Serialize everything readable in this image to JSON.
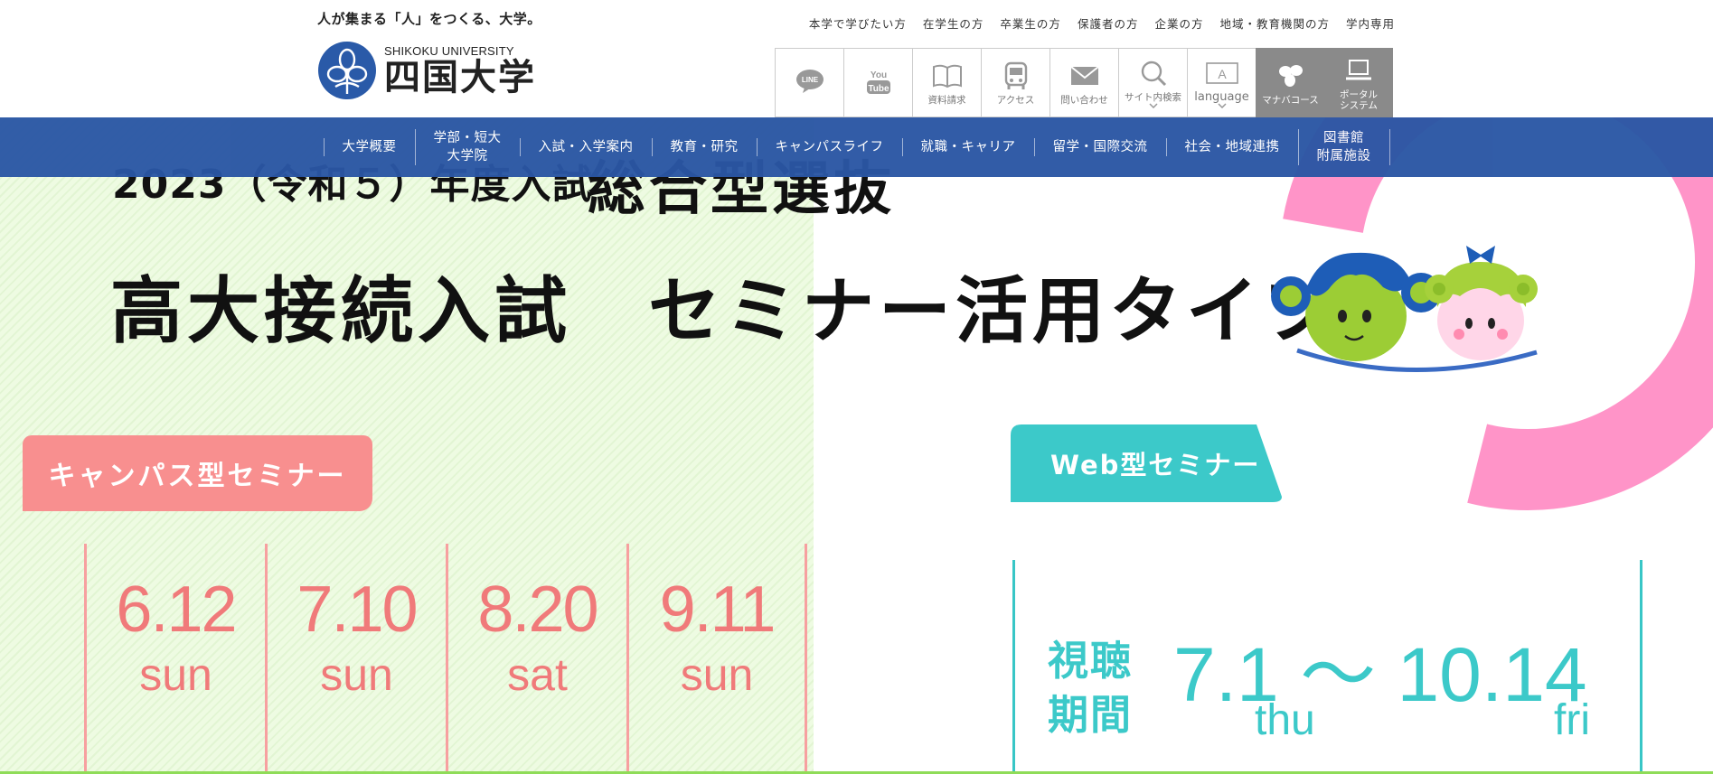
{
  "header": {
    "tagline": "人が集まる「人」をつくる、大学。",
    "logo_en": "SHIKOKU UNIVERSITY",
    "logo_ja": "四国大学",
    "top_links": [
      "本学で学びたい方",
      "在学生の方",
      "卒業生の方",
      "保護者の方",
      "企業の方",
      "地域・教育機関の方",
      "学内専用"
    ],
    "icons": [
      {
        "name": "line-icon",
        "label": ""
      },
      {
        "name": "youtube-icon",
        "label": ""
      },
      {
        "name": "book-icon",
        "label": "資料請求"
      },
      {
        "name": "bus-icon",
        "label": "アクセス"
      },
      {
        "name": "mail-icon",
        "label": "問い合わせ"
      },
      {
        "name": "search-icon",
        "label": "サイト内検索"
      },
      {
        "name": "language-icon",
        "label": "language"
      },
      {
        "name": "manaba-icon",
        "label": "マナバコース"
      },
      {
        "name": "laptop-icon",
        "label": "ポータル\nシステム"
      }
    ]
  },
  "nav": {
    "items": [
      "大学概要",
      "学部・短大\n大学院",
      "入試・入学案内",
      "教育・研究",
      "キャンパスライフ",
      "就職・キャリア",
      "留学・国際交流",
      "社会・地域連携",
      "図書館\n附属施設"
    ]
  },
  "hero": {
    "year": "2023（令和５）年度入試",
    "type": "総合型選抜",
    "main": "高大接続入試　セミナー活用タイプ",
    "campus_tag": "キャンパス型セミナー",
    "web_tag": "Web型セミナー",
    "campus_dates": [
      {
        "date": "6.12",
        "day": "sun"
      },
      {
        "date": "7.10",
        "day": "sun"
      },
      {
        "date": "8.20",
        "day": "sat"
      },
      {
        "date": "9.11",
        "day": "sun"
      }
    ],
    "web_label": "視聴\n期間",
    "web_range": "7.1 〜 10.14",
    "web_start_day": "thu",
    "web_end_day": "fri"
  },
  "colors": {
    "nav_blue": "#2a56a4",
    "campus_pink": "#f88f8f",
    "web_teal": "#3cc9c9",
    "ring_pink": "#ff94c8",
    "green_bg": "#e8f8dc"
  }
}
